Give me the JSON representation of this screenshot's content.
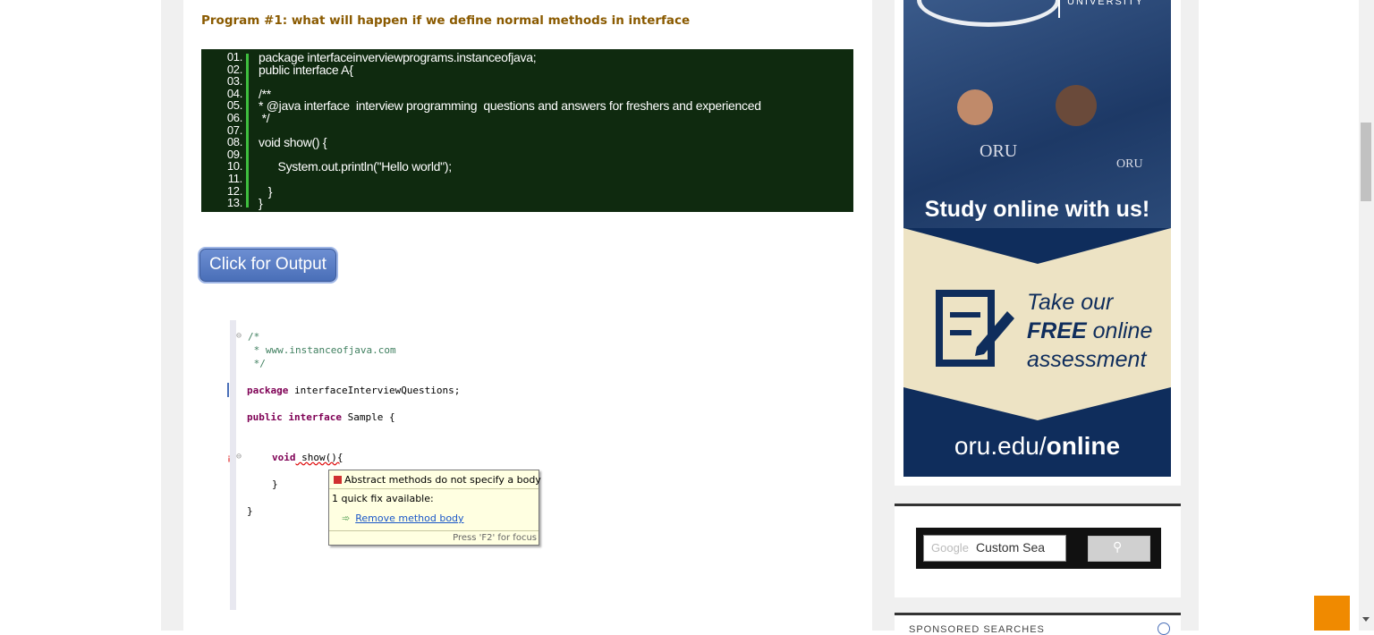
{
  "program": {
    "title": "Program #1: what will happen if we define normal methods in interface"
  },
  "code": {
    "lines": [
      {
        "num": "01.",
        "text": "package interfaceinverviewprograms.instanceofjava;"
      },
      {
        "num": "02.",
        "text": "public interface A{"
      },
      {
        "num": "03.",
        "text": ""
      },
      {
        "num": "04.",
        "text": "/**"
      },
      {
        "num": "05.",
        "text": "* @java interface  interview programming  questions and answers for freshers and experienced"
      },
      {
        "num": "06.",
        "text": " */"
      },
      {
        "num": "07.",
        "text": ""
      },
      {
        "num": "08.",
        "text": "void show() {"
      },
      {
        "num": "09.",
        "text": ""
      },
      {
        "num": "10.",
        "text": "      System.out.println(\"Hello world\");"
      },
      {
        "num": "11.",
        "text": ""
      },
      {
        "num": "12.",
        "text": "   }"
      },
      {
        "num": "13.",
        "text": "}"
      }
    ]
  },
  "output_button": {
    "label": "Click for Output"
  },
  "eclipse": {
    "comment_open": "/*",
    "comment_url": " * www.instanceofjava.com",
    "comment_close": " */",
    "package_kw": "package",
    "package_name": " interfaceInterviewQuestions;",
    "public_kw": "public",
    "interface_kw": "interface",
    "class_name": " Sample {",
    "void_kw": "void",
    "method": " show(){",
    "close_brace1": "}",
    "close_brace2": "}"
  },
  "tooltip": {
    "error": "Abstract methods do not specify a body",
    "quickfix": "1 quick fix available:",
    "fix_link": "Remove method body",
    "footer": "Press 'F2' for focus"
  },
  "ad": {
    "logo_text": "UNIVERSITY",
    "badge1": "ORU",
    "badge2": "ORU",
    "headline": "Study online with us!",
    "take": "Take our",
    "free": "FREE",
    "online": " online",
    "assessment": "assessment",
    "url_prefix": "oru.edu/",
    "url_suffix": "online"
  },
  "search": {
    "placeholder": "Custom Sea",
    "google": "Google"
  },
  "sponsored": {
    "label": "SPONSORED SEARCHES"
  },
  "colors": {
    "title": "#8a5a00",
    "code_bg": "#0f2a0f",
    "gutter_line": "#3fbf3f",
    "button": "#4a6fb8",
    "ad_navy": "#0f2d5c",
    "ad_cream": "#ede3c4",
    "orange": "#f08a00"
  }
}
